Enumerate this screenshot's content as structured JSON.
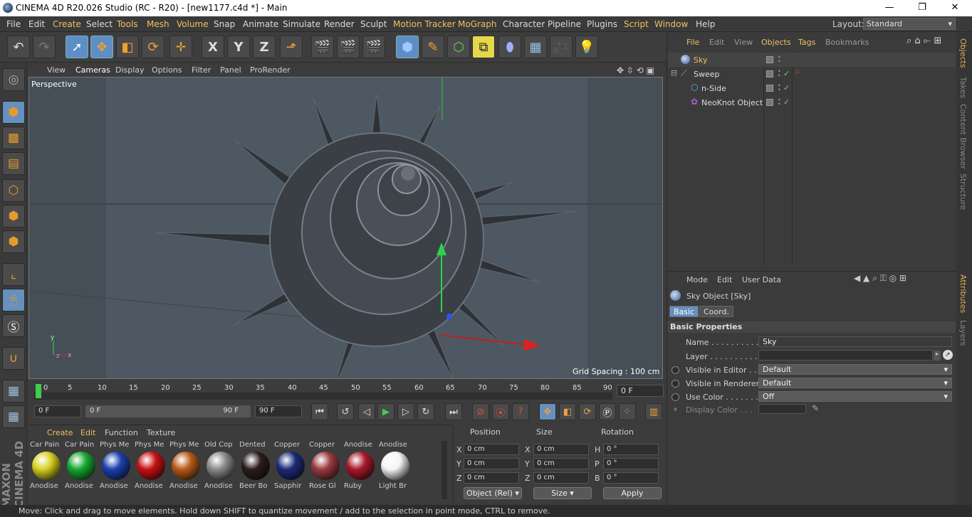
{
  "titlebar": {
    "title": "CINEMA 4D R20.026 Studio (RC - R20) - [new1177.c4d *] - Main",
    "minimize": "—",
    "maximize": "❐",
    "close": "✕"
  },
  "menubar": {
    "items": [
      "File",
      "Edit",
      "Create",
      "Select",
      "Tools",
      "Mesh",
      "Volume",
      "Snap",
      "Animate",
      "Simulate",
      "Render",
      "Sculpt",
      "Motion Tracker",
      "MoGraph",
      "Character",
      "Pipeline",
      "Plugins",
      "Script",
      "Window",
      "Help"
    ],
    "layout_label": "Layout:",
    "layout_value": "Standard"
  },
  "toolbar": {
    "axis_x": "X",
    "axis_y": "Y",
    "axis_z": "Z"
  },
  "viewport": {
    "menu": [
      "View",
      "Cameras",
      "Display",
      "Options",
      "Filter",
      "Panel",
      "ProRender"
    ],
    "label": "Perspective",
    "grid_spacing": "Grid Spacing : 100 cm"
  },
  "timeline": {
    "ticks": [
      "0",
      "5",
      "10",
      "15",
      "20",
      "25",
      "30",
      "35",
      "40",
      "45",
      "50",
      "55",
      "60",
      "65",
      "70",
      "75",
      "80",
      "85",
      "90"
    ],
    "current_frame": "0 F",
    "start_field": "0 F",
    "range_start": "0 F",
    "range_end": "90 F",
    "end_field": "90 F"
  },
  "materials": {
    "menu": [
      "Create",
      "Edit",
      "Function",
      "Texture"
    ],
    "items": [
      {
        "top": "Car Pain",
        "bottom": "Anodise",
        "color": "#d8d020"
      },
      {
        "top": "Car Pain",
        "bottom": "Anodise",
        "color": "#16a830"
      },
      {
        "top": "Phys Me",
        "bottom": "Anodise",
        "color": "#1a3fb0"
      },
      {
        "top": "Phys Me",
        "bottom": "Anodise",
        "color": "#c81010"
      },
      {
        "top": "Phys Me",
        "bottom": "Anodise",
        "color": "#b85a18"
      },
      {
        "top": "Old Cop",
        "bottom": "Anodise",
        "color": "#8a8a88"
      },
      {
        "top": "Dented",
        "bottom": "Beer Bo",
        "color": "#2a1c1c"
      },
      {
        "top": "Copper",
        "bottom": "Sapphir",
        "color": "#1c2a78"
      },
      {
        "top": "Copper",
        "bottom": "Rose Gl",
        "color": "#9a3a40"
      },
      {
        "top": "Anodise",
        "bottom": "Ruby",
        "color": "#a81828"
      },
      {
        "top": "Anodise",
        "bottom": "Light Br",
        "color": "#f4f4f4"
      }
    ]
  },
  "coords": {
    "headers": [
      "Position",
      "Size",
      "Rotation"
    ],
    "rows": [
      {
        "pl": "X",
        "pv": "0 cm",
        "sl": "X",
        "sv": "0 cm",
        "rl": "H",
        "rv": "0 °"
      },
      {
        "pl": "Y",
        "pv": "0 cm",
        "sl": "Y",
        "sv": "0 cm",
        "rl": "P",
        "rv": "0 °"
      },
      {
        "pl": "Z",
        "pv": "0 cm",
        "sl": "Z",
        "sv": "0 cm",
        "rl": "B",
        "rv": "0 °"
      }
    ],
    "mode": "Object (Rel)",
    "size_mode": "Size",
    "apply": "Apply"
  },
  "objects": {
    "menu": [
      "File",
      "Edit",
      "View",
      "Objects",
      "Tags",
      "Bookmarks"
    ],
    "items": [
      {
        "name": "Sky",
        "indent": 0
      },
      {
        "name": "Sweep",
        "indent": 0
      },
      {
        "name": "n-Side",
        "indent": 1
      },
      {
        "name": "NeoKnot Object",
        "indent": 1
      }
    ]
  },
  "right_tabs": [
    "Objects",
    "Takes",
    "Content Browser",
    "Structure",
    "Attributes",
    "Layers"
  ],
  "attributes": {
    "menu": [
      "Mode",
      "Edit",
      "User Data"
    ],
    "object_title": "Sky Object [Sky]",
    "tabs": [
      "Basic",
      "Coord."
    ],
    "section": "Basic Properties",
    "rows": [
      {
        "label": "Name . . . . . . . . . . . . .",
        "value": "Sky"
      },
      {
        "label": "Layer . . . . . . . . . . . . .",
        "value": ""
      },
      {
        "label": "Visible in Editor . . .",
        "value": "Default"
      },
      {
        "label": "Visible in Renderer",
        "value": "Default"
      },
      {
        "label": "Use Color . . . . . . . . .",
        "value": "Off"
      },
      {
        "label": "Display Color . . .",
        "value": ""
      }
    ]
  },
  "status": "Move: Click and drag to move elements. Hold down SHIFT to quantize movement / add to the selection in point mode, CTRL to remove."
}
